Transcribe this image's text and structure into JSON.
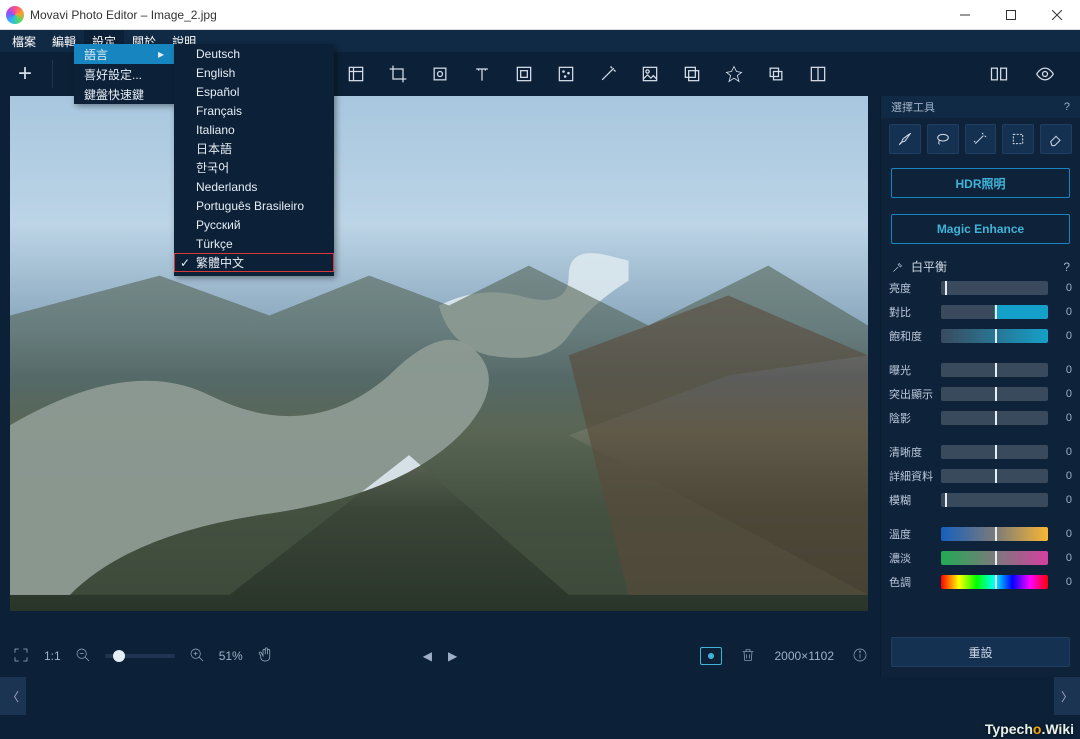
{
  "window": {
    "title": "Movavi Photo Editor – Image_2.jpg"
  },
  "menu": {
    "items": [
      "檔案",
      "編輯",
      "設定",
      "關於",
      "說明"
    ],
    "active_index": 2
  },
  "settings_menu": {
    "items": [
      {
        "label": "語言",
        "has_submenu": true,
        "active": true
      },
      {
        "label": "喜好設定...",
        "has_submenu": false,
        "active": false
      },
      {
        "label": "鍵盤快速鍵",
        "has_submenu": false,
        "active": false
      }
    ]
  },
  "language_menu": {
    "items": [
      "Deutsch",
      "English",
      "Español",
      "Français",
      "Italiano",
      "日本語",
      "한국어",
      "Nederlands",
      "Português Brasileiro",
      "Русский",
      "Türkçe",
      "繁體中文"
    ],
    "selected_index": 11
  },
  "zoom": {
    "percent": "51%",
    "onetoone": "1:1",
    "dimensions": "2000×1102"
  },
  "side": {
    "select_label": "選擇工具",
    "hdr_label": "HDR照明",
    "magic_label": "Magic Enhance",
    "wb_label": "白平衡",
    "reset_label": "重設",
    "groups": [
      {
        "rows": [
          {
            "label": "亮度",
            "value": "0",
            "track": "gray",
            "mark": "left"
          },
          {
            "label": "對比",
            "value": "0",
            "track": "half",
            "mark": "center"
          },
          {
            "label": "飽和度",
            "value": "0",
            "track": "sat",
            "mark": "center"
          }
        ]
      },
      {
        "rows": [
          {
            "label": "曝光",
            "value": "0",
            "track": "gray",
            "mark": "center"
          },
          {
            "label": "突出顯示",
            "value": "0",
            "track": "gray",
            "mark": "center"
          },
          {
            "label": "陰影",
            "value": "0",
            "track": "gray",
            "mark": "center"
          }
        ]
      },
      {
        "rows": [
          {
            "label": "清晰度",
            "value": "0",
            "track": "gray",
            "mark": "center"
          },
          {
            "label": "詳細資料",
            "value": "0",
            "track": "gray",
            "mark": "center"
          },
          {
            "label": "模糊",
            "value": "0",
            "track": "gray",
            "mark": "left"
          }
        ]
      },
      {
        "rows": [
          {
            "label": "溫度",
            "value": "0",
            "track": "temp",
            "mark": "center"
          },
          {
            "label": "濃淡",
            "value": "0",
            "track": "tint",
            "mark": "center"
          },
          {
            "label": "色調",
            "value": "0",
            "track": "hue",
            "mark": "center"
          }
        ]
      }
    ]
  },
  "watermark": {
    "t1": "Typech",
    "o": "o",
    "t2": ".Wiki"
  }
}
